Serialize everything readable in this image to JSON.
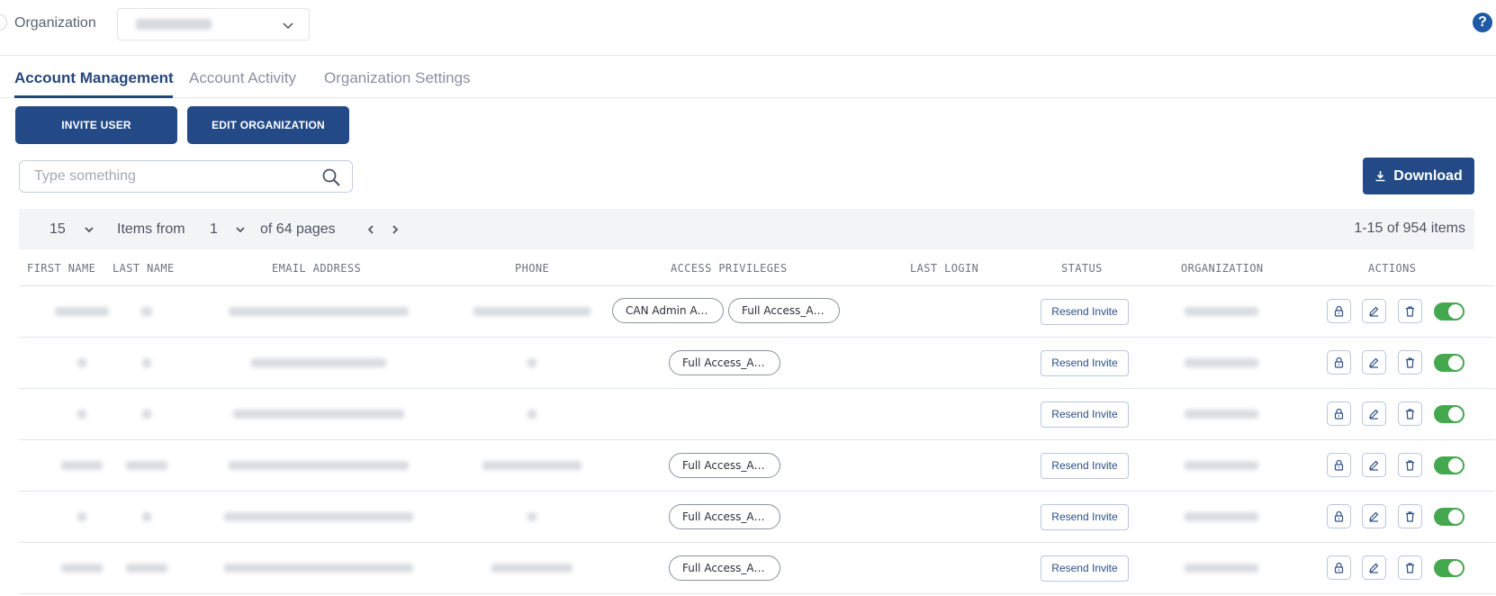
{
  "header": {
    "org_label": "Organization",
    "help_glyph": "?"
  },
  "tabs": [
    {
      "label": "Account Management",
      "active": true
    },
    {
      "label": "Account Activity",
      "active": false
    },
    {
      "label": "Organization Settings",
      "active": false
    }
  ],
  "actions": {
    "invite_label": "INVITE USER",
    "edit_org_label": "EDIT ORGANIZATION",
    "download_label": "Download"
  },
  "search": {
    "placeholder": "Type something"
  },
  "pagination": {
    "page_size": "15",
    "items_from_label": "Items from",
    "current_page": "1",
    "of_pages": "of 64 pages",
    "range_text": "1-15 of 954 items"
  },
  "table": {
    "columns": [
      "FIRST NAME",
      "LAST NAME",
      "EMAIL ADDRESS",
      "PHONE",
      "ACCESS PRIVILEGES",
      "LAST LOGIN",
      "STATUS",
      "ORGANIZATION",
      "ACTIONS"
    ],
    "rows": [
      {
        "privileges": [
          "CAN Admin Acc...",
          "Full Access_All ..."
        ],
        "status": "Resend Invite",
        "enabled": true
      },
      {
        "privileges": [
          "Full Access_All ..."
        ],
        "status": "Resend Invite",
        "enabled": true
      },
      {
        "privileges": [],
        "status": "Resend Invite",
        "enabled": true
      },
      {
        "privileges": [
          "Full Access_All ..."
        ],
        "status": "Resend Invite",
        "enabled": true
      },
      {
        "privileges": [
          "Full Access_All ..."
        ],
        "status": "Resend Invite",
        "enabled": true
      },
      {
        "privileges": [
          "Full Access_All ..."
        ],
        "status": "Resend Invite",
        "enabled": true
      }
    ]
  },
  "colors": {
    "primary": "#234a86",
    "toggle_on": "#44a84f",
    "tab_active": "#26467a"
  },
  "icons": [
    "chevron-down-icon",
    "help-icon",
    "search-icon",
    "download-icon",
    "chevron-left-icon",
    "chevron-right-icon",
    "lock-icon",
    "edit-icon",
    "trash-icon"
  ]
}
